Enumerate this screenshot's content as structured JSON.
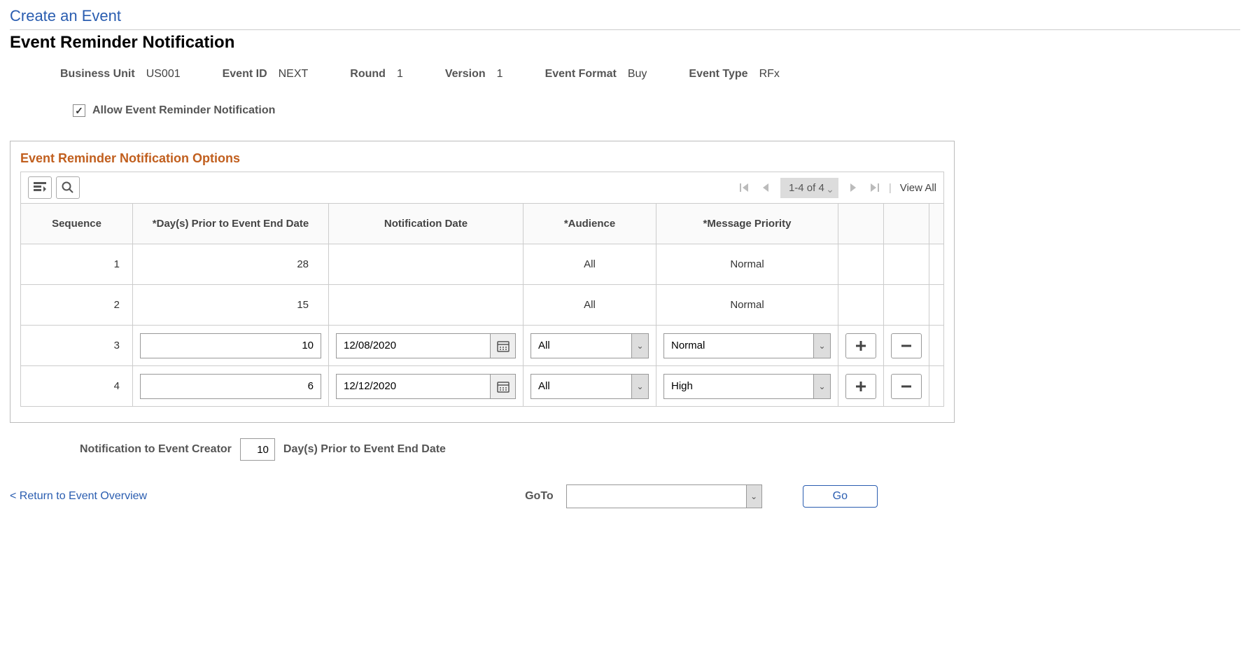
{
  "breadcrumb": "Create an Event",
  "page_title": "Event Reminder Notification",
  "meta": {
    "business_unit_label": "Business Unit",
    "business_unit_value": "US001",
    "event_id_label": "Event ID",
    "event_id_value": "NEXT",
    "round_label": "Round",
    "round_value": "1",
    "version_label": "Version",
    "version_value": "1",
    "event_format_label": "Event Format",
    "event_format_value": "Buy",
    "event_type_label": "Event Type",
    "event_type_value": "RFx"
  },
  "allow_checkbox_label": "Allow Event Reminder Notification",
  "allow_checkbox_checked": true,
  "panel_title": "Event Reminder Notification Options",
  "toolbar": {
    "page_counter": "1-4 of 4",
    "view_all": "View All"
  },
  "grid": {
    "headers": {
      "sequence": "Sequence",
      "days_prior": "*Day(s) Prior to Event End Date",
      "notification_date": "Notification Date",
      "audience": "*Audience",
      "priority": "*Message Priority"
    },
    "rows": [
      {
        "seq": "1",
        "days": "28",
        "date": "",
        "audience": "All",
        "priority": "Normal",
        "editable": false
      },
      {
        "seq": "2",
        "days": "15",
        "date": "",
        "audience": "All",
        "priority": "Normal",
        "editable": false
      },
      {
        "seq": "3",
        "days": "10",
        "date": "12/08/2020",
        "audience": "All",
        "priority": "Normal",
        "editable": true
      },
      {
        "seq": "4",
        "days": "6",
        "date": "12/12/2020",
        "audience": "All",
        "priority": "High",
        "editable": true
      }
    ]
  },
  "footer": {
    "label": "Notification to Event Creator",
    "value": "10",
    "suffix": "Day(s) Prior to Event End Date"
  },
  "return_link": "< Return to Event Overview",
  "goto": {
    "label": "GoTo",
    "value": "",
    "button": "Go"
  }
}
